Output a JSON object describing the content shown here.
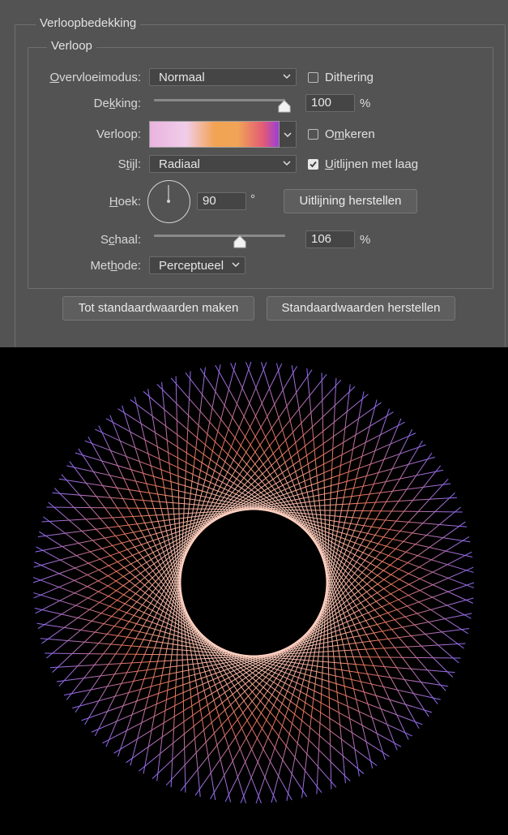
{
  "outer_group": {
    "title": "Verloopbedekking"
  },
  "inner_group": {
    "title": "Verloop"
  },
  "blend_mode": {
    "label_pre": "O",
    "label_post": "vervloeimodus:",
    "value": "Normaal"
  },
  "dithering": {
    "label": "Dithering",
    "checked": false
  },
  "opacity": {
    "label_pre": "De",
    "label_u": "k",
    "label_post": "king:",
    "value": "100",
    "unit": "%",
    "level": 100
  },
  "gradient": {
    "label": "Verloop:",
    "stops": [
      "#e9b3de",
      "#f1cdea",
      "#f3a354",
      "#f0a556",
      "#e35a76",
      "#9a3fd7"
    ]
  },
  "reverse": {
    "label_pre": "O",
    "label_u": "m",
    "label_post": "keren",
    "checked": false
  },
  "style": {
    "label_pre": "S",
    "label_u": "t",
    "label_post": "ijl:",
    "value": "Radiaal"
  },
  "align_layer": {
    "label_u": "U",
    "label_post": "itlijnen met laag",
    "checked": true
  },
  "angle": {
    "label_u": "H",
    "label_post": "oek:",
    "value": "90",
    "unit": "°",
    "degrees": 90
  },
  "reset_alignment": {
    "label": "Uitlijning herstellen"
  },
  "scale": {
    "label_pre": "S",
    "label_u": "c",
    "label_post": "haal:",
    "value": "106",
    "unit": "%",
    "level": 106
  },
  "method": {
    "label_pre": "Met",
    "label_u": "h",
    "label_post": "ode:",
    "value": "Perceptueel"
  },
  "buttons": {
    "make_default": "Tot standaardwaarden maken",
    "reset_default": "Standaardwaarden herstellen"
  },
  "colors": {
    "panel_bg": "#535353",
    "artwork_inner": "#ffd7c8",
    "artwork_mid": "#e8745a",
    "artwork_outer": "#8a6bff"
  }
}
